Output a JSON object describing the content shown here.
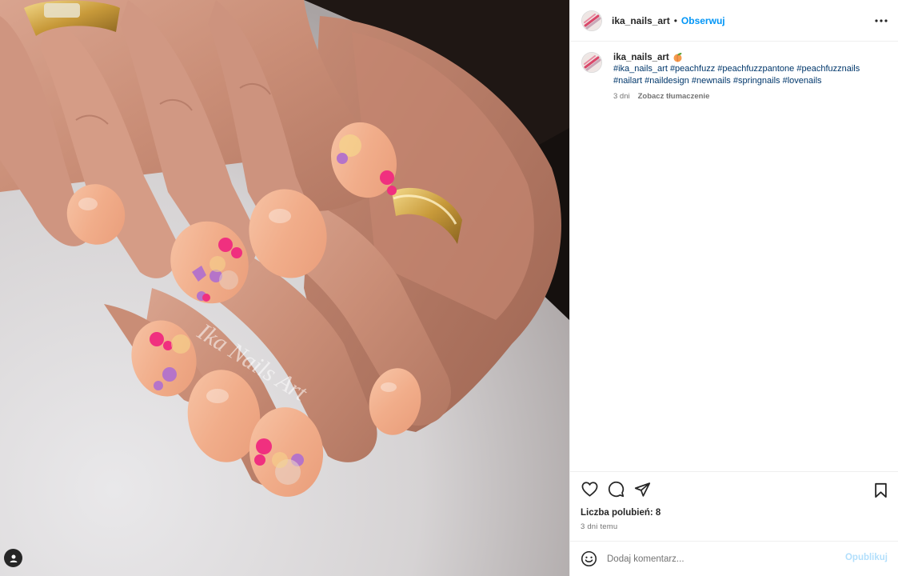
{
  "post": {
    "username": "ika_nails_art",
    "follow_label": "Obserwuj",
    "separator": "•",
    "watermark": "Ika Nails Art",
    "caption": {
      "username": "ika_nails_art",
      "hashtags": [
        "#ika_nails_art",
        "#peachfuzz",
        "#peachfuzzpantone",
        "#peachfuzznails",
        "#nailart",
        "#naildesign",
        "#newnails",
        "#springnails",
        "#lovenails"
      ],
      "age": "3 dni",
      "translate_label": "Zobacz tłumaczenie"
    },
    "likes_text": "Liczba polubień: 8",
    "posted_ago": "3 dni temu"
  },
  "comment": {
    "placeholder": "Dodaj komentarz...",
    "publish_label": "Opublikuj"
  },
  "icons": {
    "more": "more-options-icon",
    "like": "heart-icon",
    "comment": "comment-icon",
    "share": "share-icon",
    "save": "bookmark-icon",
    "emoji": "emoji-icon",
    "user_tags": "user-tag-icon",
    "peach": "peach-emoji-icon"
  },
  "colors": {
    "accent": "#0095f6",
    "link": "#00376b",
    "publish_disabled": "#b2dffc",
    "nail_polish": "#f4b08d",
    "flower_pink": "#f0307f",
    "flower_purple": "#b574c9"
  }
}
